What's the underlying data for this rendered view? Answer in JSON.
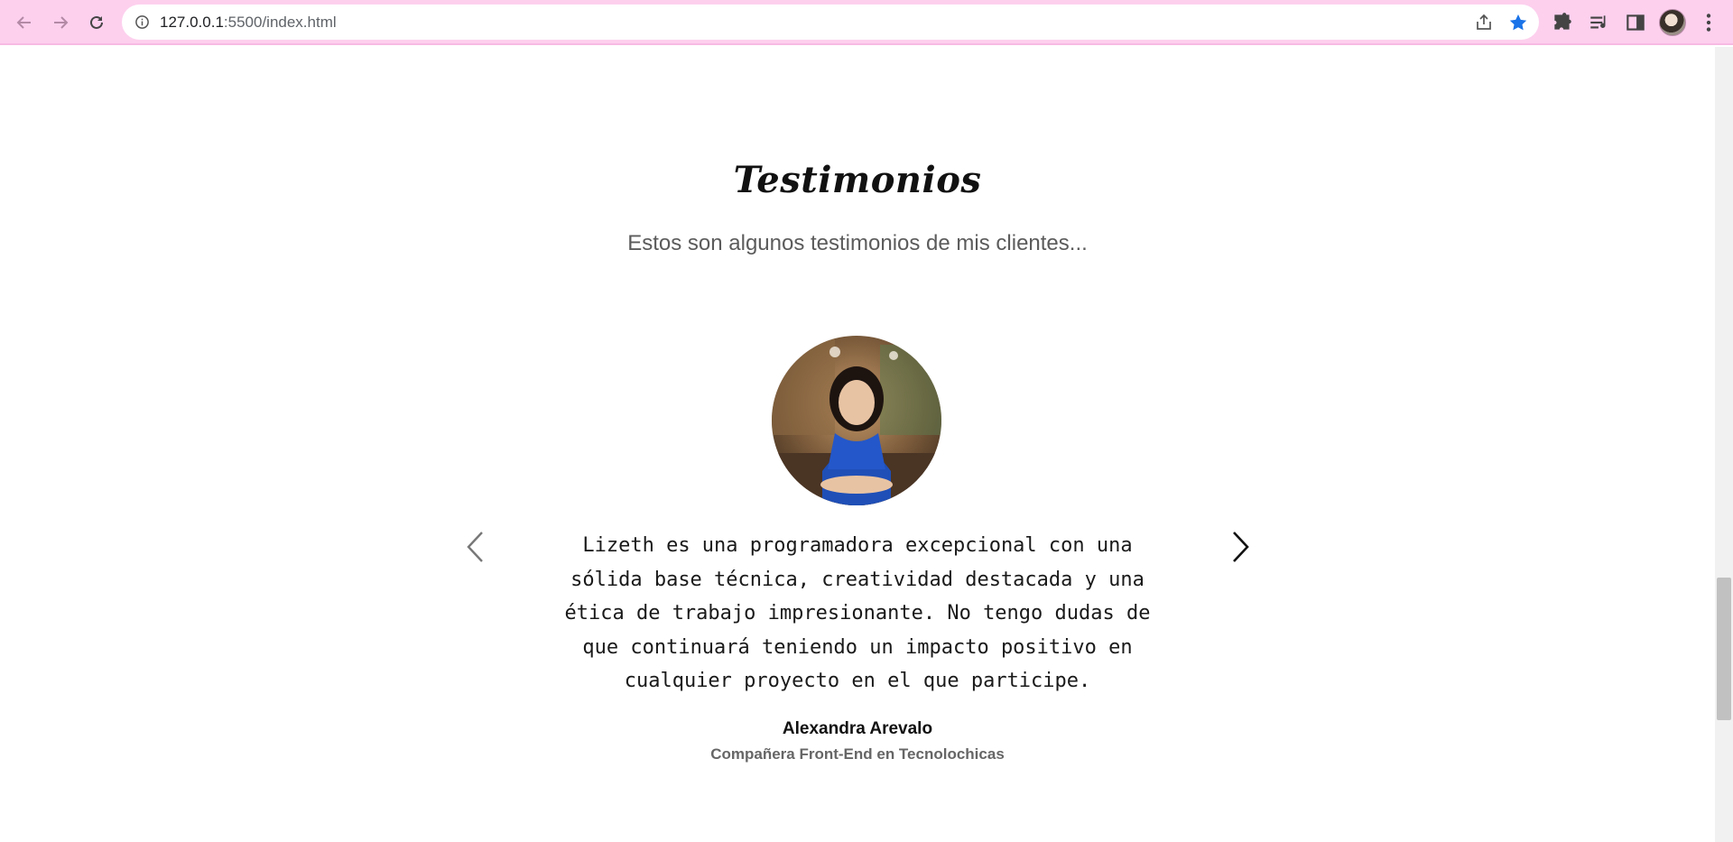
{
  "browser": {
    "url_host": "127.0.0.1",
    "url_path": ":5500/index.html",
    "icons": {
      "back": "arrow-left-icon",
      "forward": "arrow-right-icon",
      "reload": "reload-icon",
      "site_info": "info-icon",
      "share": "share-icon",
      "bookmark": "star-icon",
      "extensions": "puzzle-icon",
      "media": "media-queue-icon",
      "side_panel": "side-panel-icon",
      "profile": "avatar",
      "menu": "kebab-menu-icon"
    },
    "colors": {
      "frame": "#fdd0ee",
      "bookmark_star": "#1a73e8"
    }
  },
  "section": {
    "title": "Testimonios",
    "subtitle": "Estos son algunos testimonios de mis clientes..."
  },
  "testimonial": {
    "quote": "Lizeth es una programadora excepcional con una sólida base técnica, creatividad destacada y una ética de trabajo impresionante. No tengo dudas de que continuará teniendo un impacto positivo en cualquier proyecto en el que participe.",
    "author": "Alexandra Arevalo",
    "role": "Compañera Front-End en Tecnolochicas"
  },
  "carousel": {
    "prev_icon": "chevron-left-icon",
    "next_icon": "chevron-right-icon"
  }
}
